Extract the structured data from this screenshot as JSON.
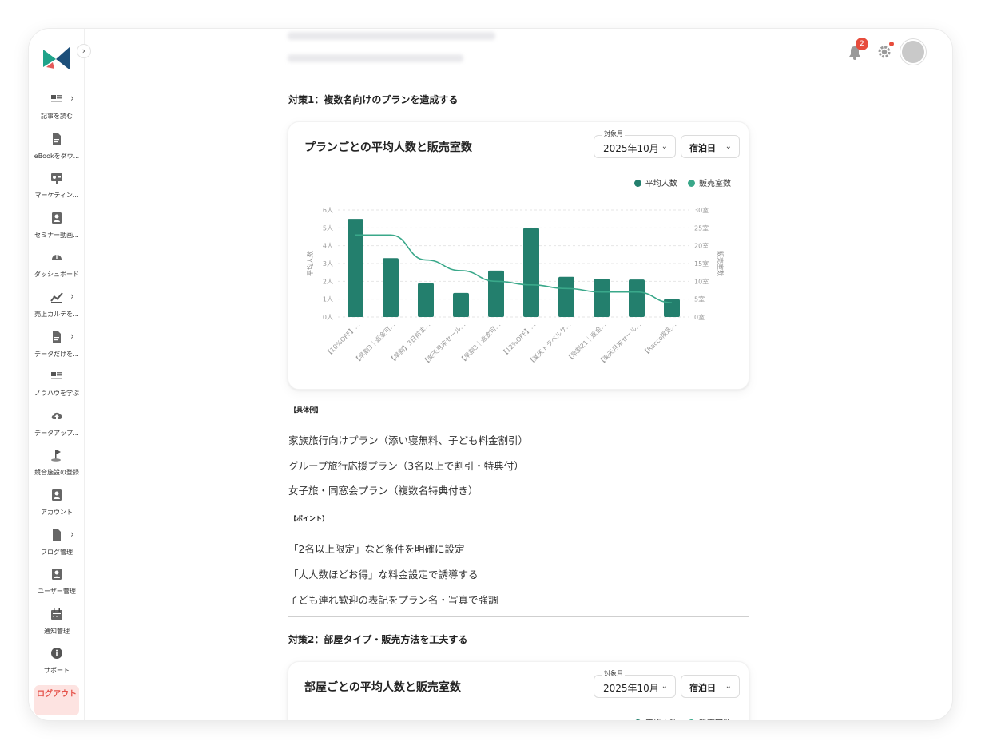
{
  "sidebar": {
    "items": [
      {
        "label": "記事を読む",
        "icon": "newspaper-icon",
        "chevron": true
      },
      {
        "label": "eBookをダウ...",
        "icon": "document-icon",
        "chevron": false
      },
      {
        "label": "マーケティン...",
        "icon": "presentation-icon",
        "chevron": false
      },
      {
        "label": "セミナー動画...",
        "icon": "user-card-icon",
        "chevron": false
      },
      {
        "label": "ダッシュボード",
        "icon": "gauge-icon",
        "chevron": false
      },
      {
        "label": "売上カルテを...",
        "icon": "trend-chart-icon",
        "chevron": true
      },
      {
        "label": "データだけを...",
        "icon": "document-icon",
        "chevron": true
      },
      {
        "label": "ノウハウを学ぶ",
        "icon": "newspaper-icon",
        "chevron": false
      },
      {
        "label": "データアップ...",
        "icon": "cloud-upload-icon",
        "chevron": false
      },
      {
        "label": "競合施設の登録",
        "icon": "flag-icon",
        "chevron": false
      },
      {
        "label": "アカウント",
        "icon": "user-card-icon",
        "chevron": false
      },
      {
        "label": "ブログ管理",
        "icon": "file-icon",
        "chevron": true
      },
      {
        "label": "ユーザー管理",
        "icon": "user-card-icon",
        "chevron": false
      },
      {
        "label": "通知管理",
        "icon": "calendar-icon",
        "chevron": false
      },
      {
        "label": "サポート",
        "icon": "info-icon",
        "chevron": false
      }
    ],
    "logout_label": "ログアウト"
  },
  "header": {
    "notification_count": "2"
  },
  "section1": {
    "title": "対策1：複数名向けのプランを造成する",
    "card": {
      "title": "プランごとの平均人数と販売室数",
      "month_caption": "対象月",
      "month_value": "2025年10月",
      "type_value": "宿泊日"
    },
    "example_heading": "【具体例】",
    "examples": [
      "家族旅行向けプラン（添い寝無料、子ども料金割引）",
      "グループ旅行応援プラン（3名以上で割引・特典付）",
      "女子旅・同窓会プラン（複数名特典付き）"
    ],
    "point_heading": "【ポイント】",
    "points": [
      "「2名以上限定」など条件を明確に設定",
      "「大人数ほどお得」な料金設定で誘導する",
      "子ども連れ歓迎の表記をプラン名・写真で強調"
    ]
  },
  "section2": {
    "title": "対策2：部屋タイプ・販売方法を工夫する",
    "card": {
      "title": "部屋ごとの平均人数と販売室数",
      "month_caption": "対象月",
      "month_value": "2025年10月",
      "type_value": "宿泊日"
    }
  },
  "chart_data": {
    "type": "bar",
    "categories": [
      "【10%OFF】...",
      "【早割3｜返金可...",
      "【早割】3日前ま...",
      "【楽天月末セール...",
      "【早割3｜返金可...",
      "【12%OFF】...",
      "【楽天トラベルサ...",
      "【早割21｜返金...",
      "【楽天月末セール...",
      "【Racco限定..."
    ],
    "series": [
      {
        "name": "平均人数",
        "type": "bar",
        "axis": "left",
        "color": "#237f6d",
        "values": [
          5.5,
          3.3,
          1.9,
          1.35,
          2.6,
          5.0,
          2.25,
          2.15,
          2.1,
          1.0
        ]
      },
      {
        "name": "販売室数",
        "type": "line",
        "axis": "right",
        "color": "#3aa88a",
        "values": [
          23,
          23,
          16,
          13,
          10,
          9,
          8,
          7,
          7,
          4
        ]
      }
    ],
    "y_left": {
      "label": "平均人数",
      "min": 0,
      "max": 6,
      "ticks": [
        "0人",
        "1人",
        "2人",
        "3人",
        "4人",
        "5人",
        "6人"
      ]
    },
    "y_right": {
      "label": "販売室数",
      "min": 0,
      "max": 30,
      "ticks": [
        "0室",
        "5室",
        "10室",
        "15室",
        "20室",
        "25室",
        "30室"
      ]
    },
    "legend": "top-right",
    "grid": true
  },
  "colors": {
    "bar": "#237f6d",
    "line": "#3aa88a",
    "logout_bg": "#fde3e1",
    "logout_text": "#e5534b",
    "badge": "#e74c3c"
  }
}
